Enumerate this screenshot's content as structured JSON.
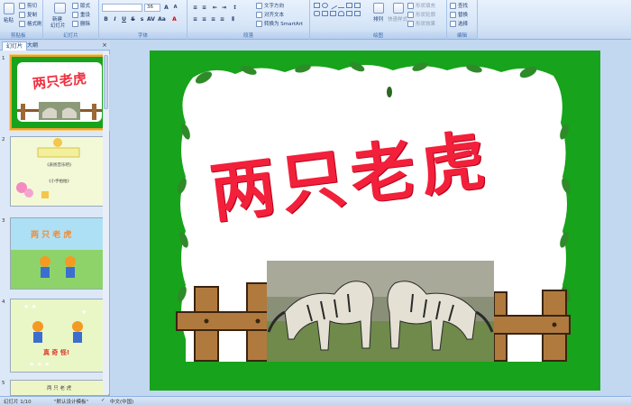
{
  "ribbon": {
    "clipboard": {
      "paste": "粘贴",
      "cut": "剪切",
      "copy": "复制",
      "format_painter": "格式刷",
      "label": "剪贴板"
    },
    "slides": {
      "new_slide": "新建",
      "new_slide_2": "幻灯片",
      "layout": "版式",
      "reset": "重设",
      "delete": "删除",
      "label": "幻灯片"
    },
    "font": {
      "size": "36",
      "label": "字体"
    },
    "paragraph": {
      "text_direction": "文字方向",
      "align_text": "对齐文本",
      "smartart": "转换为 SmartArt",
      "label": "段落"
    },
    "drawing": {
      "arrange": "排列",
      "quick_styles": "快速样式",
      "fill": "形状填充",
      "outline": "形状轮廓",
      "effects": "形状效果",
      "label": "绘图"
    },
    "editing": {
      "find": "查找",
      "replace": "替换",
      "select": "选择",
      "label": "编辑"
    }
  },
  "pane": {
    "tab_slides": "幻灯片",
    "tab_outline": "大纲",
    "close": "×",
    "thumbs": [
      {
        "num": "1"
      },
      {
        "num": "2",
        "line1": "《表扬音乐吧》",
        "line2": "《小手拍拍》"
      },
      {
        "num": "3",
        "title": "两 只 老 虎"
      },
      {
        "num": "4",
        "line1": "真 奇 怪!"
      },
      {
        "num": "5",
        "title": "两 只 老 虎"
      }
    ]
  },
  "slide": {
    "title": "两只老虎"
  },
  "status": {
    "slide_count": "幻灯片 1/10",
    "theme": "\"默认设计模板\"",
    "lang": "中文(中国)"
  }
}
